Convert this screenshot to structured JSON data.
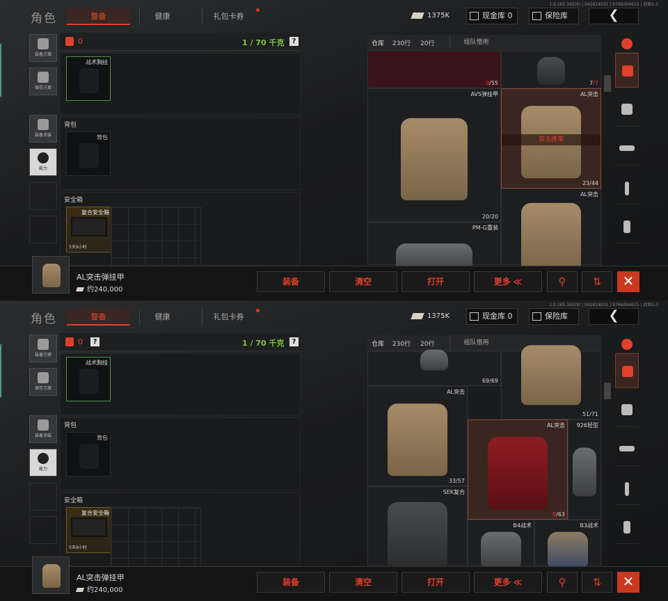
{
  "screens": [
    {
      "version": "1.0.165.165(9) | 042614031 | 9766064615 | 对局1-3",
      "title": "角色",
      "tabs": {
        "outfit": "整备",
        "health": "健康",
        "gift": "礼包卡券"
      },
      "currency": "1375K",
      "cash_vault": "现金库 0",
      "vault": "保险库",
      "side": {
        "plan": "装备方案",
        "save": "保存方案",
        "paint": "装备涂装",
        "ability": "能力"
      },
      "loadout": {
        "count": "0",
        "weight": "1 / 70 千克"
      },
      "sections": {
        "rig": "战术胸挂",
        "bag_section": "背包",
        "bag_slot": "背包",
        "safe_section": "安全箱",
        "safe_item": "复合安全箱",
        "safe_time": "5天9小时"
      },
      "warehouse": {
        "name": "仓库",
        "rows": "230行",
        "rows2": "20行",
        "team": "组队借用"
      },
      "items": [
        {
          "name": "",
          "count": "0",
          "count_total": "/55"
        },
        {
          "name": "",
          "count": "7",
          "count_total": "/7"
        },
        {
          "name": "AVS弹挂甲",
          "count": "20/20"
        },
        {
          "name": "AL突击",
          "count": "23/44",
          "banner": "双击携带"
        },
        {
          "name": "PM-G重装",
          "count": ""
        },
        {
          "name": "AL突击",
          "count": ""
        }
      ],
      "selected": {
        "name": "AL突击弹挂甲",
        "price": "约240,000"
      },
      "actions": {
        "equip": "装备",
        "clear": "清空",
        "open": "打开",
        "more": "更多 ≪"
      }
    },
    {
      "version": "1.0.165.165(9) | 042614031 | 9766064615 | 对局1-3",
      "title": "角色",
      "tabs": {
        "outfit": "整备",
        "health": "健康",
        "gift": "礼包卡券"
      },
      "currency": "1375K",
      "cash_vault": "现金库 0",
      "vault": "保险库",
      "side": {
        "plan": "装备方案",
        "save": "保存方案",
        "paint": "装备涂装",
        "ability": "能力"
      },
      "loadout": {
        "count": "0",
        "weight": "1 / 70 千克"
      },
      "sections": {
        "rig": "战术胸挂",
        "bag_section": "背包",
        "bag_slot": "背包",
        "safe_section": "安全箱",
        "safe_item": "复合安全箱",
        "safe_time": "5天9小时"
      },
      "warehouse": {
        "name": "仓库",
        "rows": "230行",
        "rows2": "20行",
        "team": "组队借用"
      },
      "items": [
        {
          "name": "",
          "count": "69/69"
        },
        {
          "name": "",
          "count": "51/71"
        },
        {
          "name": "AL突击",
          "count": "33/57"
        },
        {
          "name": "AL突击",
          "count": "",
          "count_red": "0",
          "count_total": "/63"
        },
        {
          "name": "926轻型",
          "count": ""
        },
        {
          "name": "SEK复合",
          "count": ""
        },
        {
          "name": "B4战术",
          "count": ""
        },
        {
          "name": "B3战术",
          "count": ""
        }
      ],
      "selected": {
        "name": "AL突击弹挂甲",
        "price": "约240,000"
      },
      "actions": {
        "equip": "装备",
        "clear": "清空",
        "open": "打开",
        "more": "更多 ≪"
      }
    }
  ]
}
